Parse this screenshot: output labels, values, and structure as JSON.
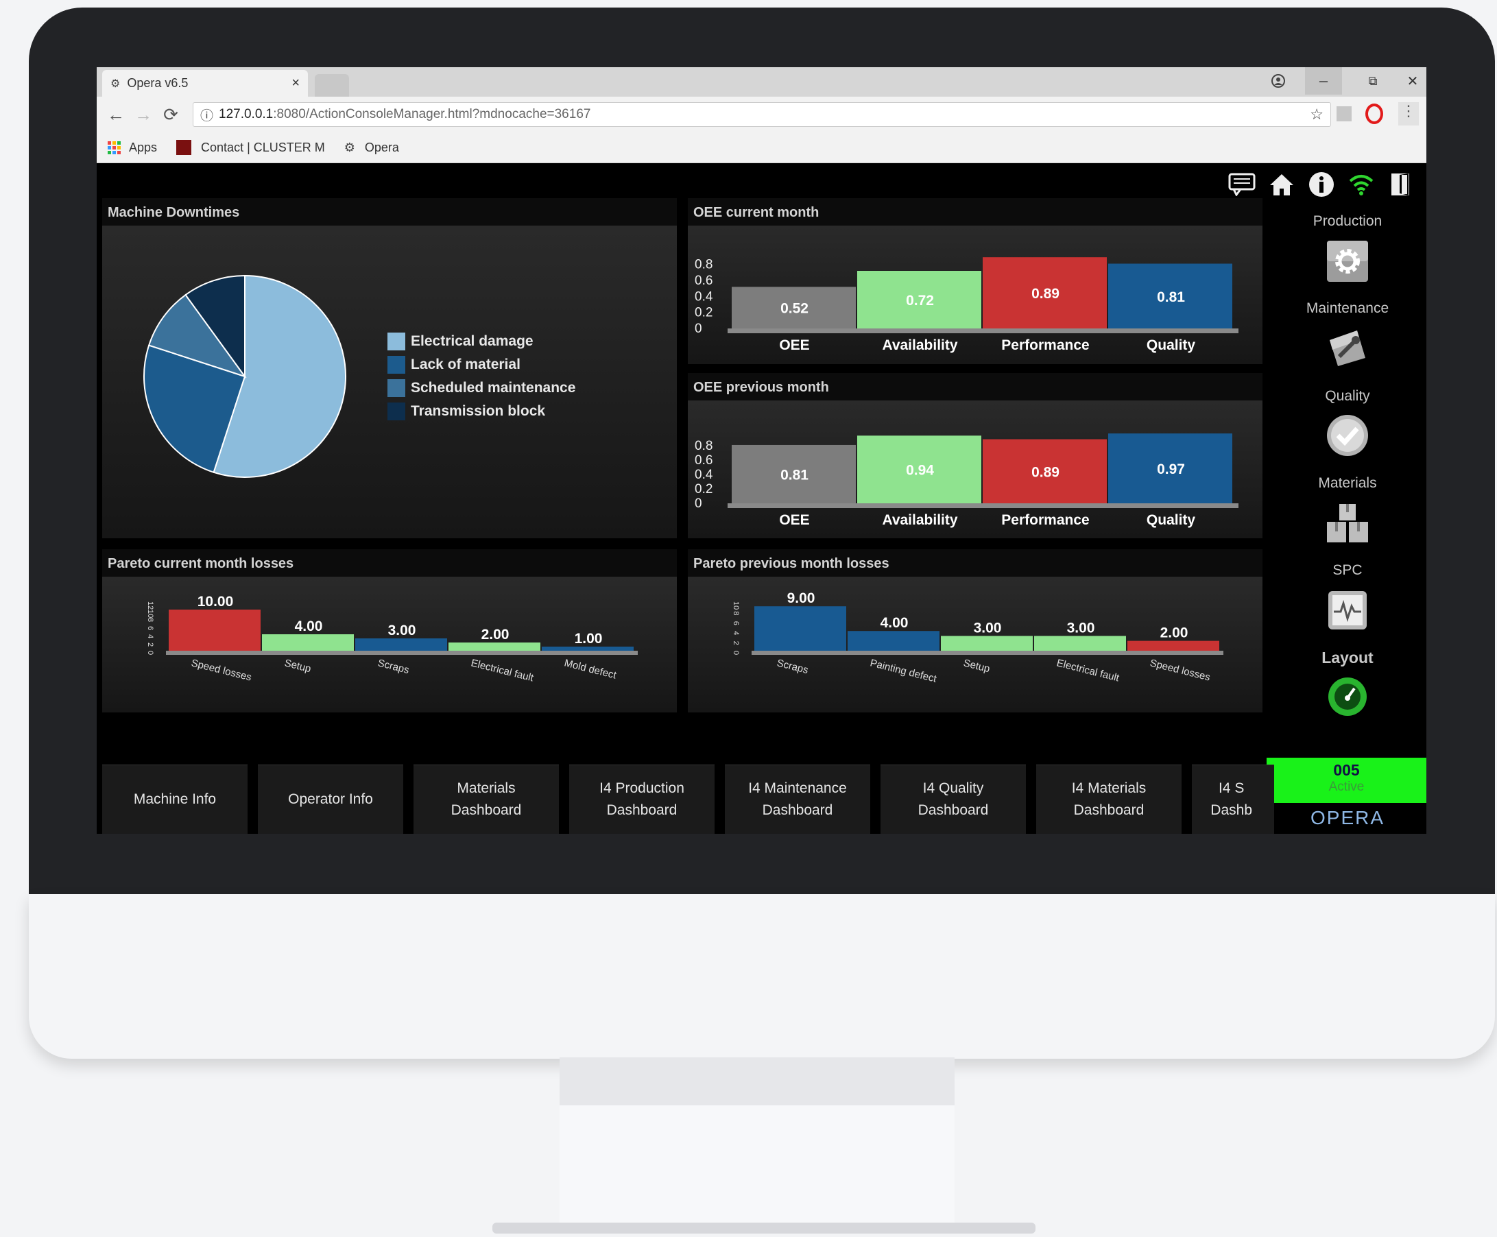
{
  "browser": {
    "tab_title": "Opera v6.5",
    "tab_close": "×",
    "url_host": "127.0.0.1",
    "url_rest": ":8080/ActionConsoleManager.html?mdnocache=36167",
    "bookmarks": [
      {
        "label": "Apps"
      },
      {
        "label": "Contact | CLUSTER M"
      },
      {
        "label": "Opera"
      }
    ],
    "win_min": "–",
    "win_restore": "⧉",
    "win_close": "✕"
  },
  "panels": {
    "downtimes": "Machine Downtimes",
    "oee_current": "OEE current month",
    "oee_previous": "OEE previous month",
    "pareto_current": "Pareto current month losses",
    "pareto_previous": "Pareto previous month losses"
  },
  "chart_data": [
    {
      "id": "downtimes",
      "type": "pie",
      "labels": [
        "Electrical damage",
        "Lack of material",
        "Scheduled maintenance",
        "Transmission block"
      ],
      "values": [
        55,
        25,
        10,
        10
      ],
      "colors": [
        "#8cbcdc",
        "#1c5b8d",
        "#3b729b",
        "#0d2e4d"
      ],
      "legend": "right"
    },
    {
      "id": "oee_current",
      "type": "bar",
      "categories": [
        "OEE",
        "Availability",
        "Performance",
        "Quality"
      ],
      "values": [
        0.52,
        0.72,
        0.89,
        0.81
      ],
      "value_labels": [
        "0.52",
        "0.72",
        "0.89",
        "0.81"
      ],
      "colors": [
        "#7d7d7d",
        "#8fe38f",
        "#c93333",
        "#185a92"
      ],
      "yticks": [
        "0.8",
        "0.6",
        "0.4",
        "0.2",
        "0"
      ],
      "ylim": [
        0,
        0.9
      ]
    },
    {
      "id": "oee_previous",
      "type": "bar",
      "categories": [
        "OEE",
        "Availability",
        "Performance",
        "Quality"
      ],
      "values": [
        0.81,
        0.94,
        0.89,
        0.97
      ],
      "value_labels": [
        "0.81",
        "0.94",
        "0.89",
        "0.97"
      ],
      "colors": [
        "#7d7d7d",
        "#8fe38f",
        "#c93333",
        "#185a92"
      ],
      "yticks": [
        "0.8",
        "0.6",
        "0.4",
        "0.2",
        "0"
      ],
      "ylim": [
        0,
        1.0
      ]
    },
    {
      "id": "pareto_current",
      "type": "bar",
      "categories": [
        "Speed losses",
        "Setup",
        "Scraps",
        "Electrical fault",
        "Mold defect"
      ],
      "values": [
        10,
        4,
        3,
        2,
        1
      ],
      "value_labels": [
        "10.00",
        "4.00",
        "3.00",
        "2.00",
        "1.00"
      ],
      "colors": [
        "#c93333",
        "#8fe38f",
        "#185a92",
        "#8fe38f",
        "#185a92"
      ],
      "yticks": [
        "12",
        "10",
        "8",
        "6",
        "4",
        "2",
        "0"
      ],
      "ylim": [
        0,
        12
      ]
    },
    {
      "id": "pareto_previous",
      "type": "bar",
      "categories": [
        "Scraps",
        "Painting defect",
        "Setup",
        "Electrical fault",
        "Speed losses"
      ],
      "values": [
        9,
        4,
        3,
        3,
        2
      ],
      "value_labels": [
        "9.00",
        "4.00",
        "3.00",
        "3.00",
        "2.00"
      ],
      "colors": [
        "#185a92",
        "#185a92",
        "#8fe38f",
        "#8fe38f",
        "#c93333"
      ],
      "yticks": [
        "10",
        "8",
        "6",
        "4",
        "2",
        "0"
      ],
      "ylim": [
        0,
        10
      ]
    }
  ],
  "sidebar": {
    "production": "Production",
    "maintenance": "Maintenance",
    "quality": "Quality",
    "materials": "Materials",
    "spc": "SPC",
    "layout": "Layout"
  },
  "status": {
    "code": "005",
    "state": "Active",
    "logo": "OPERA"
  },
  "bottom_buttons": [
    "Machine Info",
    "Operator Info",
    "Materials Dashboard",
    "I4 Production Dashboard",
    "I4 Maintenance Dashboard",
    "I4 Quality Dashboard",
    "I4 Materials Dashboard",
    "I4 S Dashb"
  ],
  "colors": {
    "active_green": "#19f219",
    "bg": "#000000"
  }
}
